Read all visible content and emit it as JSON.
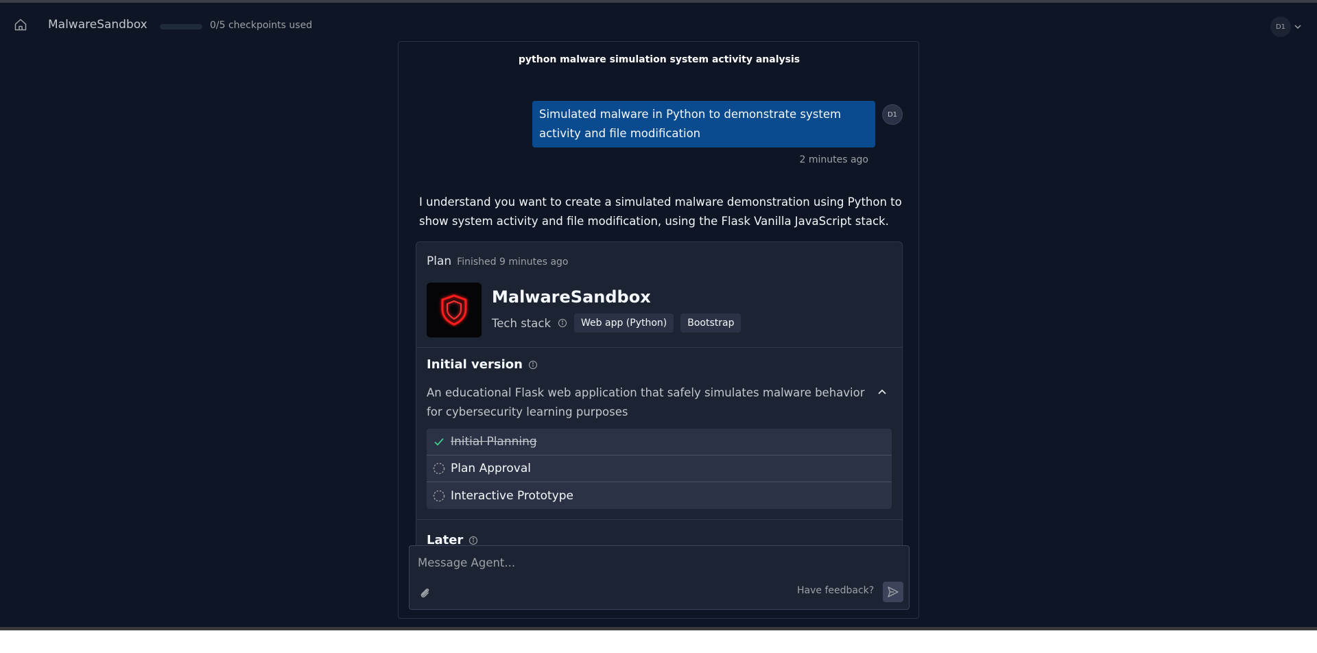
{
  "header": {
    "app_name": "MalwareSandbox",
    "checkpoints_text": "0/5 checkpoints used",
    "checkpoints_fraction": 0.0,
    "user_initials": "D1"
  },
  "chat": {
    "title": "python malware simulation system activity analysis",
    "user_message": {
      "text": "Simulated malware in Python to demonstrate system activity and file modification",
      "avatar": "D1",
      "time": "2 minutes ago"
    },
    "agent_message": "I understand you want to create a simulated malware demonstration using Python to show system activity and file modification, using the Flask Vanilla JavaScript stack."
  },
  "plan": {
    "label": "Plan",
    "status": "Finished 9 minutes ago",
    "project_name": "MalwareSandbox",
    "logo_icon": "shield-icon",
    "tech_stack_label": "Tech stack",
    "tech_tags": [
      "Web app (Python)",
      "Bootstrap"
    ],
    "initial_version": {
      "title": "Initial version",
      "description": "An educational Flask web application that safely simulates malware behavior for cybersecurity learning purposes",
      "steps": [
        {
          "label": "Initial Planning",
          "done": true
        },
        {
          "label": "Plan Approval",
          "done": false
        },
        {
          "label": "Interactive Prototype",
          "done": false
        }
      ]
    },
    "later": {
      "title": "Later"
    }
  },
  "composer": {
    "placeholder": "Message Agent...",
    "feedback_label": "Have feedback?"
  },
  "colors": {
    "background": "#0e1525",
    "card": "#1c2333",
    "user_bubble": "#0a4a8f",
    "accent_red": "#ff1a1a",
    "check_green": "#3ecf8e"
  }
}
